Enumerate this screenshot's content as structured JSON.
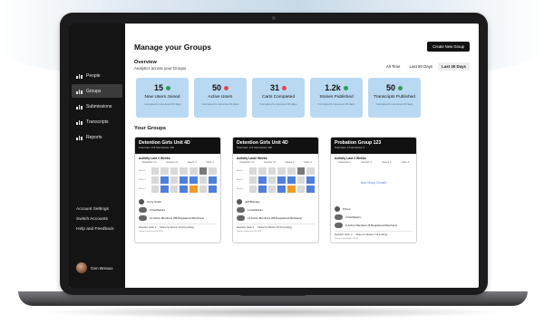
{
  "nav": {
    "items": [
      {
        "label": "People",
        "icon": "bar-chart-icon",
        "active": false
      },
      {
        "label": "Groups",
        "icon": "bar-chart-icon",
        "active": true
      },
      {
        "label": "Submissions",
        "icon": "bar-chart-icon",
        "active": false
      },
      {
        "label": "Transcripts",
        "icon": "bar-chart-icon",
        "active": false
      },
      {
        "label": "Reports",
        "icon": "bar-chart-icon",
        "active": false
      }
    ],
    "bottom": [
      "Account Settings",
      "Switch Accounts",
      "Help and Feedback"
    ],
    "user_name": "Gen Breaux"
  },
  "header": {
    "title": "Manage your Groups",
    "create_label": "Create New Group"
  },
  "overview": {
    "title": "Overview",
    "subtitle": "Analytics across your Groups",
    "periods": [
      "All Time",
      "Last 90 Days",
      "Last 30 Days"
    ],
    "selected_period": "Last 30 Days"
  },
  "stats": [
    {
      "value": "15",
      "label": "New Users Joined",
      "trend": "up",
      "note": "Compared to previous 30 days"
    },
    {
      "value": "50",
      "label": "Active Users",
      "trend": "down",
      "note": "Compared to previous 30 days"
    },
    {
      "value": "31",
      "label": "Carts Completed",
      "trend": "down",
      "note": "Compared to previous 30 days"
    },
    {
      "value": "1.2k",
      "label": "Stories Published",
      "trend": "up",
      "note": "Compared to previous 30 days"
    },
    {
      "value": "50",
      "label": "Transcripts Published",
      "trend": "up",
      "note": "Compared to previous 30 days"
    }
  ],
  "groups_title": "Your Groups",
  "groups": [
    {
      "name": "Detention Girls Unit 4D",
      "meta": "Total Carts: 270   Total Stories: 396",
      "activity_label": "Activity Last 2 Weeks",
      "columns": [
        "Cassandra: 3.4",
        "Genesis: 16",
        "Aleeza: 6",
        "Carts: 4"
      ],
      "rows": [
        {
          "label": "Week 1",
          "cells": [
            "g",
            "g",
            "g",
            "g",
            "g",
            "k",
            "g"
          ]
        },
        {
          "label": "Week 2",
          "cells": [
            "g",
            "b",
            "g",
            "b",
            "b",
            "g",
            "b"
          ]
        },
        {
          "label": "Week 3",
          "cells": [
            "g",
            "b",
            "g",
            "b",
            "o",
            "g",
            "b"
          ]
        }
      ],
      "placeholder": "",
      "lead": "Curry Smith",
      "facilitators": "3 Facilitators",
      "members": "11 Active Members  (86 Registered Members)",
      "foot": [
        "Detention Carts: 1",
        "Stories for Review: 26 (16 pending)"
      ],
      "note": "Group Created Jan 05 2022"
    },
    {
      "name": "Detention Girls Unit 4D",
      "meta": "Total Carts: 270   Total Stories: 396",
      "activity_label": "Activity Last2 Weeks",
      "columns": [
        "Cassandra: 3.4",
        "Genesis: 16",
        "Aleeza: 6",
        "Carts: 4"
      ],
      "rows": [
        {
          "label": "Week 1",
          "cells": [
            "g",
            "g",
            "g",
            "g",
            "g",
            "k",
            "g"
          ]
        },
        {
          "label": "Week 2",
          "cells": [
            "g",
            "b",
            "g",
            "b",
            "b",
            "g",
            "b"
          ]
        },
        {
          "label": "Week 3",
          "cells": [
            "g",
            "b",
            "g",
            "b",
            "o",
            "g",
            "b"
          ]
        }
      ],
      "placeholder": "",
      "lead": "Jeff Brantley",
      "facilitators": "1 Facilitators",
      "members": "11 Active Members  (86 Registered Members)",
      "foot": [
        "Detention Carts: 1",
        "Stories for Review: 26 (16 pending)"
      ],
      "note": "Group Created Jan 05 2022"
    },
    {
      "name": "Probation Group 123",
      "meta": "Total Carts: 0   Total Stories: 0",
      "activity_label": "Activity Last 2 Weeks",
      "columns": [
        "Cassandra: 0",
        "Genesis: 0",
        "Aleeza: 0",
        "Carts: 0"
      ],
      "rows": [],
      "placeholder": "New Group Created",
      "lead": "Prince",
      "facilitators": "2 Facilitators",
      "members": "5 Active Members  (5 Registered Members)",
      "foot": [
        "Detention Carts: 0",
        "Stories for Review: 0 (0 pending)"
      ],
      "note": "Group Created Mar 2 2022"
    }
  ],
  "colors": {
    "sidebar": "#141414",
    "stat_bg": "#b9d9f2",
    "cell_blue": "#4f7fd9",
    "cell_orange": "#f19a28",
    "up": "#2f9e55",
    "down": "#e04848"
  }
}
